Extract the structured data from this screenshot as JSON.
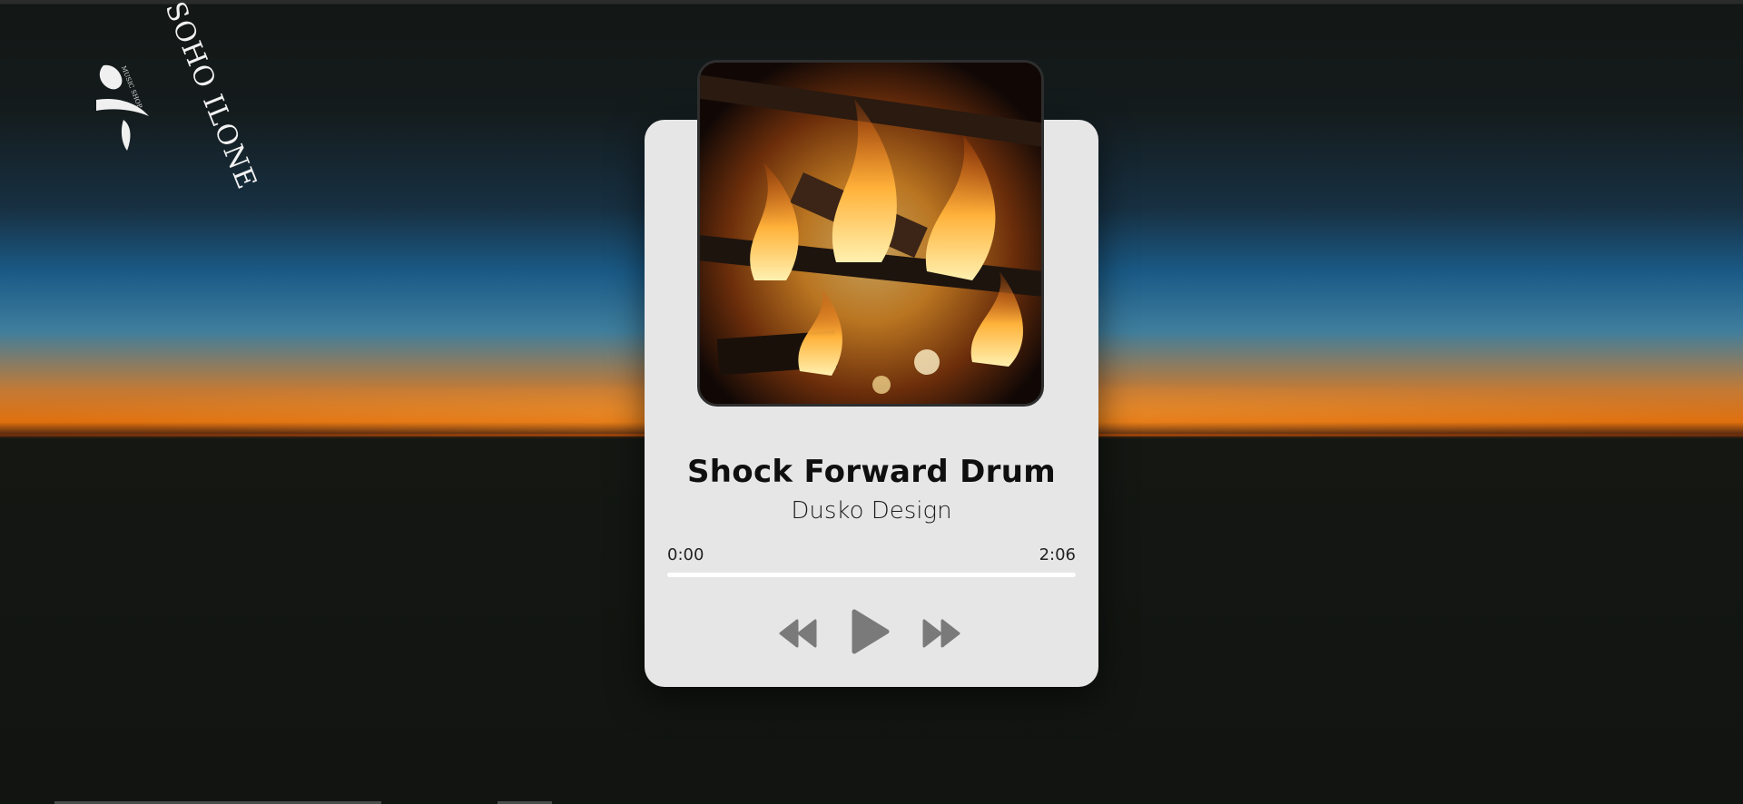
{
  "logo": {
    "text": "SOHO ILONE",
    "subtext": "MUSIC SHOP"
  },
  "player": {
    "title": "Shock Forward Drum",
    "artist": "Dusko Design",
    "time_current": "0:00",
    "time_total": "2:06",
    "progress": 0,
    "cover_icon": "campfire-image"
  },
  "controls": {
    "prev_icon": "rewind-icon",
    "play_icon": "play-icon",
    "next_icon": "fast-forward-icon"
  },
  "colors": {
    "card_bg": "#e6e6e6",
    "control_color": "#7a7a7a",
    "page_bg": "#111411"
  }
}
